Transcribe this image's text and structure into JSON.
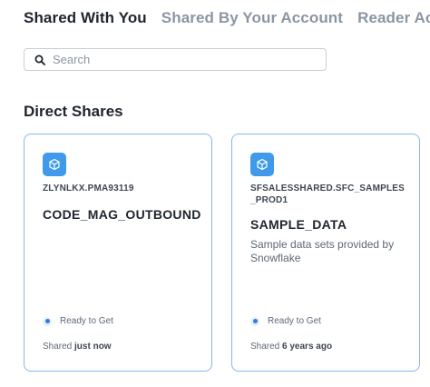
{
  "tabs": [
    {
      "label": "Shared With You",
      "active": true
    },
    {
      "label": "Shared By Your Account",
      "active": false
    },
    {
      "label": "Reader Accounts",
      "active": false
    }
  ],
  "search": {
    "placeholder": "Search",
    "value": ""
  },
  "section": {
    "title": "Direct Shares"
  },
  "cards": [
    {
      "provider": "ZLYNLKX.PMA93119",
      "name": "CODE_MAG_OUTBOUND",
      "description": "",
      "status": "Ready to Get",
      "shared_prefix": "Shared",
      "shared_time": "just now"
    },
    {
      "provider": "SFSALESSHARED.SFC_SAMPLES_PROD1",
      "name": "SAMPLE_DATA",
      "description": "Sample data sets provided by Snowflake",
      "status": "Ready to Get",
      "shared_prefix": "Shared",
      "shared_time": "6 years ago"
    }
  ],
  "colors": {
    "accent": "#3f9be9",
    "card_border": "#8ab4f0",
    "status_dot": "#2e7de0"
  },
  "icons": {
    "search": "search-icon",
    "card_logo": "cube-icon",
    "status": "status-dot-icon"
  }
}
